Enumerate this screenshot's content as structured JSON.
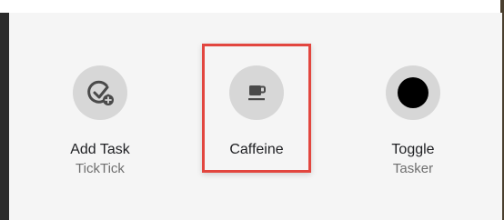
{
  "tiles": [
    {
      "name": "Add Task",
      "sub": "TickTick",
      "icon": "check-add-icon"
    },
    {
      "name": "Caffeine",
      "sub": "",
      "icon": "coffee-cup-icon"
    },
    {
      "name": "Toggle",
      "sub": "Tasker",
      "icon": "circle-toggle-icon"
    }
  ],
  "colors": {
    "panel_bg": "#f5f5f5",
    "tile_circle": "#d7d7d7",
    "highlight": "#e2463f",
    "icon": "#4a4a4a"
  }
}
